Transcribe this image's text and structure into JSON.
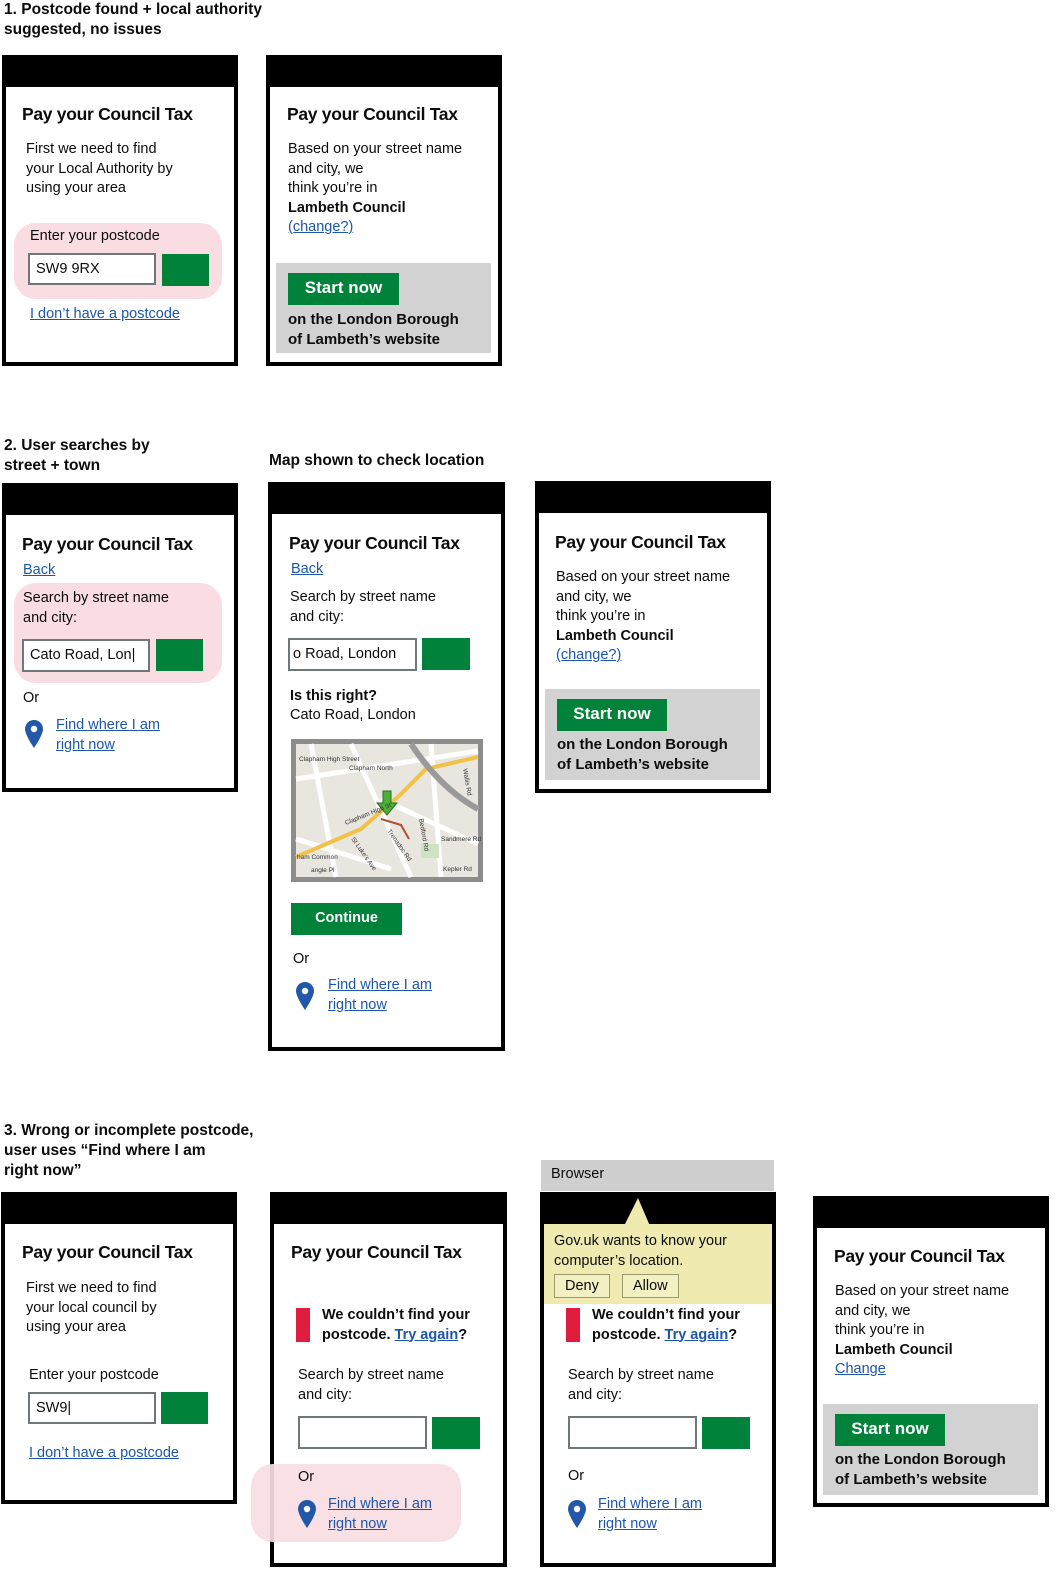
{
  "sections": {
    "s1": "1. Postcode found + local authority\nsuggested, no issues",
    "s2": "2. User searches by\nstreet + town",
    "s2_map": "Map shown to check location",
    "s3": "3. Wrong or incomplete postcode,\nuser uses “Find where I am\nright now”"
  },
  "common": {
    "title": "Pay your Council Tax",
    "start_now": "Start now",
    "continue": "Continue",
    "or": "Or",
    "find_l1": "Find where I am",
    "find_l2": "right now",
    "back": "Back",
    "no_postcode": "I don’t have a postcode",
    "enter_postcode": "Enter your postcode",
    "search_l1": "Search by street name",
    "search_l2": "and city:",
    "based_l1": "Based on your street name",
    "based_l2": "and city, we",
    "based_l3": "think you’re in",
    "council": "Lambeth Council",
    "change_q": "(change?)",
    "change": "Change",
    "on_l1": "on the London Borough",
    "on_l2": "of Lambeth’s website",
    "err_l1": "We couldn’t find your",
    "err_l2": "postcode.",
    "try_again": "Try again",
    "q": "?"
  },
  "p1": {
    "intro": [
      "First we need to find",
      "your Local Authority by",
      "using your area"
    ],
    "postcode_value": "SW9 9RX"
  },
  "p3": {
    "search_value": "Cato Road, Lon|"
  },
  "p4": {
    "search_value": "o Road, London",
    "is_right": "Is this right?",
    "location": "Cato Road, London",
    "map_labels": {
      "a": "Clapham High Street",
      "b": "Clapham North",
      "c": "Clapham High St",
      "d": "Trenadoc Rd",
      "e": "St Luke's Ave",
      "f": "Bedford Rd",
      "g": "Sandmere Rd",
      "h": "Kepler Rd",
      "i": "ham Common",
      "j": "Wallis Rd",
      "k": "angle Pl"
    }
  },
  "p6": {
    "intro": [
      "First we need to find",
      "your local council by",
      "using your area"
    ],
    "postcode_value": "SW9|"
  },
  "browser": {
    "label": "Browser",
    "prompt_l1": "Gov.uk wants to know your",
    "prompt_l2": "computer’s location.",
    "deny": "Deny",
    "allow": "Allow"
  },
  "colors": {
    "green": "#00823b",
    "link": "#1d56a8",
    "highlight": "#f9dde3",
    "error": "#e11d3f",
    "pin": "#2358a8"
  }
}
